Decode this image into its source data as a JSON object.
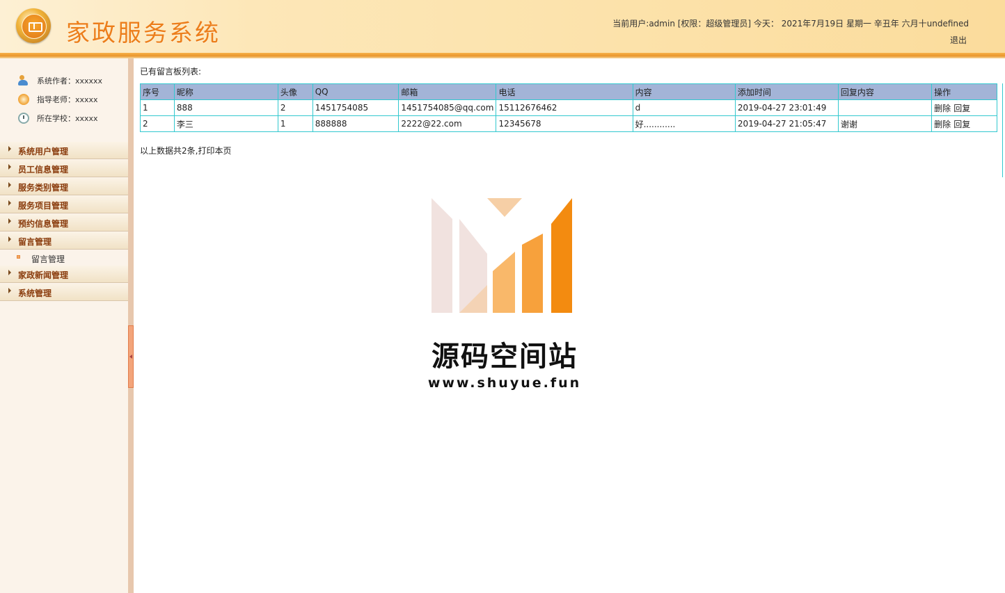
{
  "header": {
    "title": "家政服务系统",
    "user_info": "当前用户:admin [权限：超级管理员] 今天： 2021年7月19日 星期一 辛丑年 六月十undefined",
    "logout": "退出"
  },
  "sidebar": {
    "info": [
      {
        "label": "系统作者：xxxxxx",
        "icon": "user-icon"
      },
      {
        "label": "指导老师：xxxxx",
        "icon": "teacher-icon"
      },
      {
        "label": "所在学校：xxxxx",
        "icon": "clock-icon"
      }
    ],
    "menu": [
      {
        "label": "系统用户管理"
      },
      {
        "label": "员工信息管理"
      },
      {
        "label": "服务类别管理"
      },
      {
        "label": "服务项目管理"
      },
      {
        "label": "预约信息管理"
      },
      {
        "label": "留言管理",
        "expanded": true,
        "children": [
          {
            "label": "留言管理"
          }
        ]
      },
      {
        "label": "家政新闻管理"
      },
      {
        "label": "系统管理"
      }
    ]
  },
  "main": {
    "list_title": "已有留言板列表:",
    "columns": [
      "序号",
      "昵称",
      "头像",
      "QQ",
      "邮箱",
      "电话",
      "内容",
      "添加时间",
      "回复内容",
      "操作"
    ],
    "rows": [
      {
        "index": "1",
        "nickname": "888",
        "avatar": "2",
        "qq": "1451754085",
        "email": "1451754085@qq.com",
        "phone": "15112676462",
        "content": "d",
        "time": "2019-04-27 23:01:49",
        "reply": "",
        "delete": "删除",
        "reply_action": "回复"
      },
      {
        "index": "2",
        "nickname": "李三",
        "avatar": "1",
        "qq": "888888",
        "email": "2222@22.com",
        "phone": "12345678",
        "content": "好............",
        "time": "2019-04-27 21:05:47",
        "reply": "谢谢",
        "delete": "删除",
        "reply_action": "回复"
      }
    ],
    "summary_prefix": "以上数据共2条,",
    "print_link": "打印本页"
  },
  "watermark": {
    "text": "源码空间站",
    "url": "www.shuyue.fun"
  },
  "colors": {
    "title_orange": "#ec7e1b",
    "menu_text": "#8a3c0d",
    "table_header": "#a3b4d7",
    "table_border": "#32c8cf"
  }
}
